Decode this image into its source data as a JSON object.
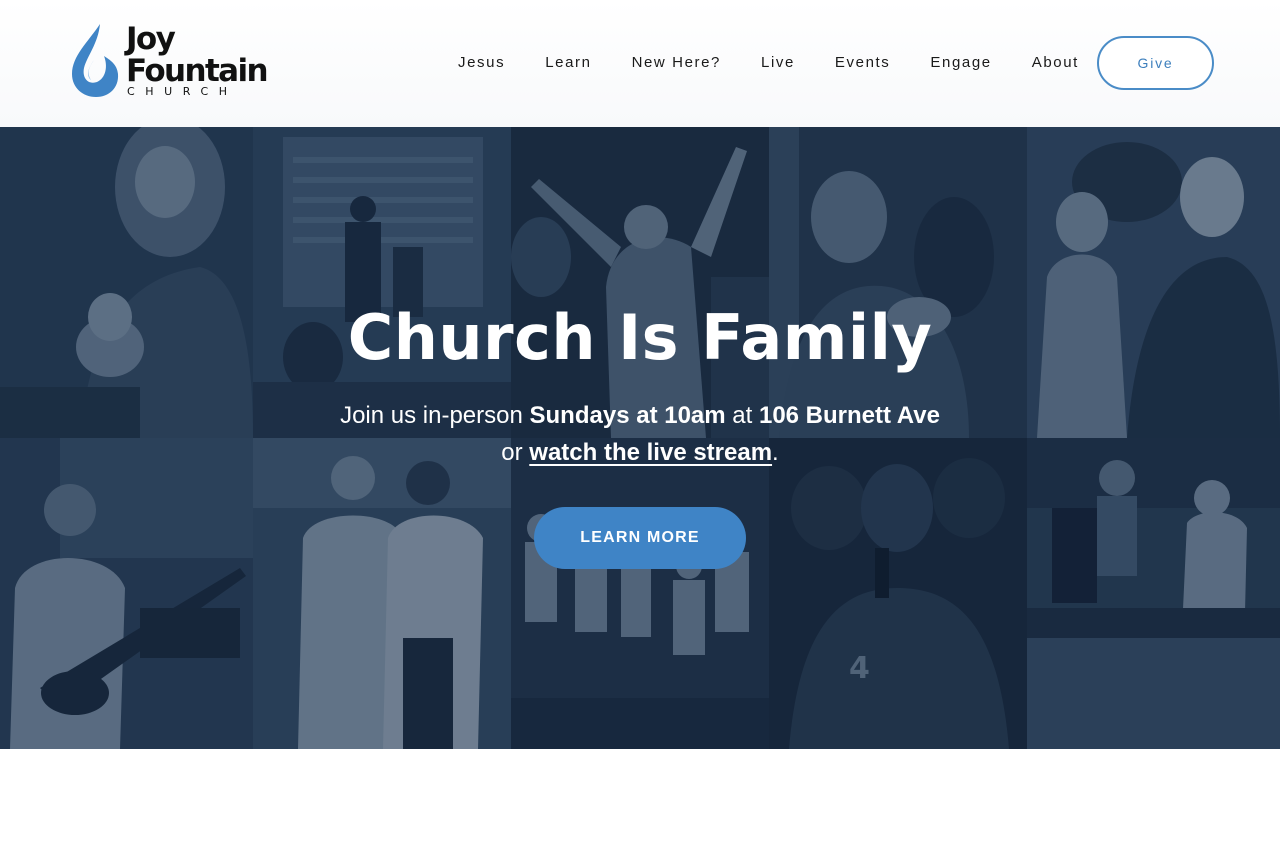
{
  "brand": {
    "name_line1": "Joy",
    "name_line2": "Fountain",
    "name_line3": "CHURCH",
    "logo_icon": "water-drop-icon",
    "accent_color": "#3f84c6"
  },
  "nav": {
    "items": [
      {
        "label": "Jesus"
      },
      {
        "label": "Learn"
      },
      {
        "label": "New Here?"
      },
      {
        "label": "Live"
      },
      {
        "label": "Events"
      },
      {
        "label": "Engage"
      },
      {
        "label": "About"
      }
    ],
    "give_label": "Give"
  },
  "hero": {
    "title": "Church Is Family",
    "line1_prefix": "Join us in-person ",
    "line1_time": "Sundays at 10am",
    "line1_mid": " at ",
    "line1_address": "106 Burnett Ave",
    "line2_prefix": "or ",
    "line2_link": "watch the live stream",
    "line2_suffix": ".",
    "cta_label": "LEARN MORE",
    "background_photos": [
      "mother-and-baby-photo",
      "speaker-on-stage-photo",
      "worship-raised-hand-photo",
      "people-embracing-photo",
      "woman-with-child-photo",
      "bass-guitarist-photo",
      "women-volunteers-photo",
      "kids-group-photo",
      "man-with-microphone-photo",
      "outdoor-event-photo"
    ]
  }
}
